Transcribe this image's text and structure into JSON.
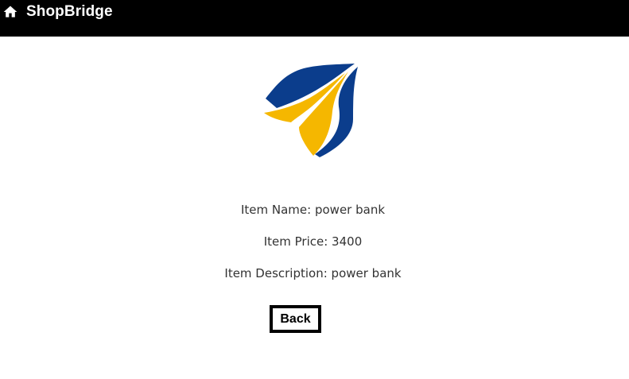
{
  "header": {
    "home_icon": "home-icon",
    "brand": "ShopBridge"
  },
  "logo": {
    "name": "shopbridge-logo",
    "colors": {
      "blue": "#0b3d8c",
      "yellow": "#f5b700"
    }
  },
  "item": {
    "name_line": "Item Name: power bank",
    "price_line": "Item Price: 3400",
    "description_line": "Item Description: power bank"
  },
  "actions": {
    "back_label": "Back"
  }
}
